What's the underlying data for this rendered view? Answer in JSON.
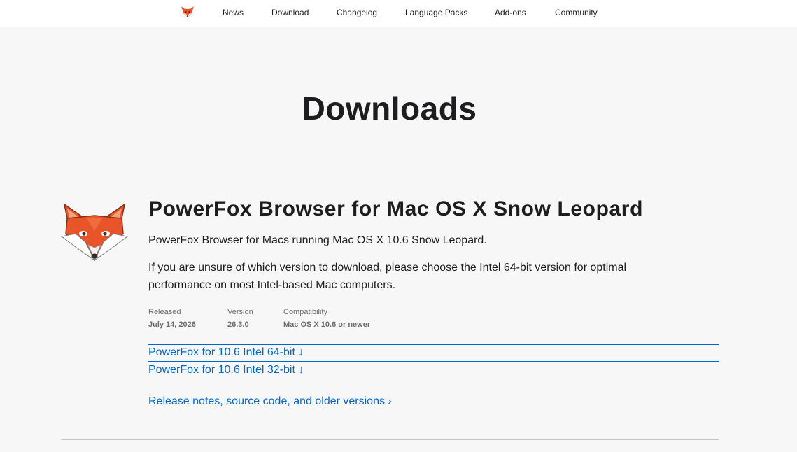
{
  "nav": {
    "items": [
      {
        "label": "News"
      },
      {
        "label": "Download"
      },
      {
        "label": "Changelog"
      },
      {
        "label": "Language Packs"
      },
      {
        "label": "Add-ons"
      },
      {
        "label": "Community"
      }
    ]
  },
  "page": {
    "title": "Downloads"
  },
  "product": {
    "title": "PowerFox Browser for Mac OS X Snow Leopard",
    "description": "PowerFox Browser for Macs running Mac OS X 10.6 Snow Leopard.",
    "note": "If you are unsure of which version to download, please choose the Intel 64-bit version for optimal performance on most Intel-based Mac computers.",
    "meta": {
      "released_label": "Released",
      "released_value": "July 14, 2026",
      "version_label": "Version",
      "version_value": "26.3.0",
      "compat_label": "Compatibility",
      "compat_value": "Mac OS X 10.6 or newer"
    },
    "downloads": [
      {
        "label": "PowerFox for 10.6 Intel 64-bit ↓"
      },
      {
        "label": "PowerFox for 10.6 Intel 32-bit ↓"
      }
    ],
    "release_notes_label": "Release notes, source code, and older versions ›"
  },
  "colors": {
    "link": "#0066cc",
    "fox_orange": "#e8552b",
    "background": "#f7f7f7"
  }
}
